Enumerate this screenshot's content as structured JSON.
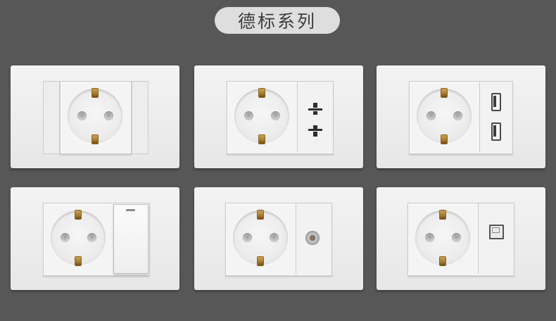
{
  "header": {
    "title": "德标系列"
  },
  "products": [
    {
      "name": "german-socket-single",
      "modules": []
    },
    {
      "name": "german-socket-with-2pin-outlet",
      "modules": [
        "two-pin-outlet"
      ]
    },
    {
      "name": "german-socket-with-usb",
      "modules": [
        "usb-port",
        "usb-port"
      ]
    },
    {
      "name": "german-socket-with-switch",
      "modules": [
        "rocker-switch"
      ]
    },
    {
      "name": "german-socket-with-tv",
      "modules": [
        "tv-coax-jack"
      ]
    },
    {
      "name": "german-socket-with-network",
      "modules": [
        "rj45-jack"
      ]
    }
  ],
  "colors": {
    "background": "#575757",
    "plate": "#efefef",
    "title_pill": "#dedede",
    "earth_contact": "#b08636"
  }
}
